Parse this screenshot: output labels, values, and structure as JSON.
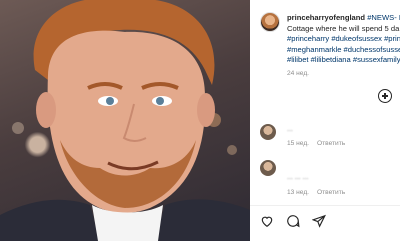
{
  "post": {
    "username": "princeharryofengland",
    "caption_lines": [
      "#NEWS- H",
      "Cottage where he will spend 5 da",
      "#princeharry #dukeofsussex #prin",
      "#meghanmarkle #duchessofsusse",
      "#lilibet #lilibetdiana #sussexfamily"
    ],
    "time": "24 нед."
  },
  "comments": [
    {
      "time": "15 нед.",
      "reply": "Ответить",
      "text": ""
    },
    {
      "time": "",
      "reply": "",
      "text": "..."
    },
    {
      "time": "13 нед.",
      "reply": "Ответить",
      "text": "... ... ..."
    }
  ],
  "icons": [
    "heart-icon",
    "comment-icon",
    "share-icon",
    "add-comment-icon"
  ],
  "colors": {
    "hashtag": "#00376b",
    "muted": "#8e8e8e",
    "text": "#262626"
  }
}
